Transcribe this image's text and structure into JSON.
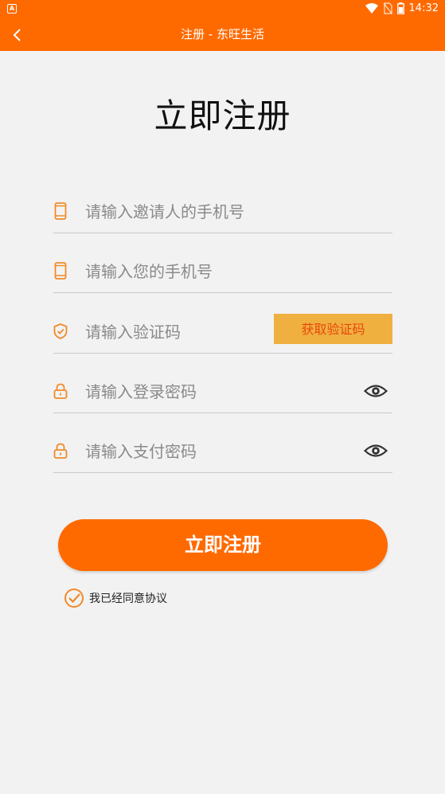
{
  "status_bar": {
    "time": "14:32",
    "app_badge": "A"
  },
  "header": {
    "title": "注册 - 东旺生活"
  },
  "page_title": "立即注册",
  "fields": {
    "inviter_phone": {
      "placeholder": "请输入邀请人的手机号",
      "icon": "phone-icon"
    },
    "phone": {
      "placeholder": "请输入您的手机号",
      "icon": "phone-icon"
    },
    "verify_code": {
      "placeholder": "请输入验证码",
      "icon": "shield-icon",
      "button_label": "获取验证码"
    },
    "login_password": {
      "placeholder": "请输入登录密码",
      "icon": "lock-icon"
    },
    "pay_password": {
      "placeholder": "请输入支付密码",
      "icon": "lock-icon"
    }
  },
  "register_button": {
    "label": "立即注册"
  },
  "agreement": {
    "label": "我已经同意协议",
    "checked": true
  },
  "colors": {
    "accent": "#ff6a00",
    "code_button_bg": "#f0b040",
    "code_button_text": "#e8480b"
  }
}
